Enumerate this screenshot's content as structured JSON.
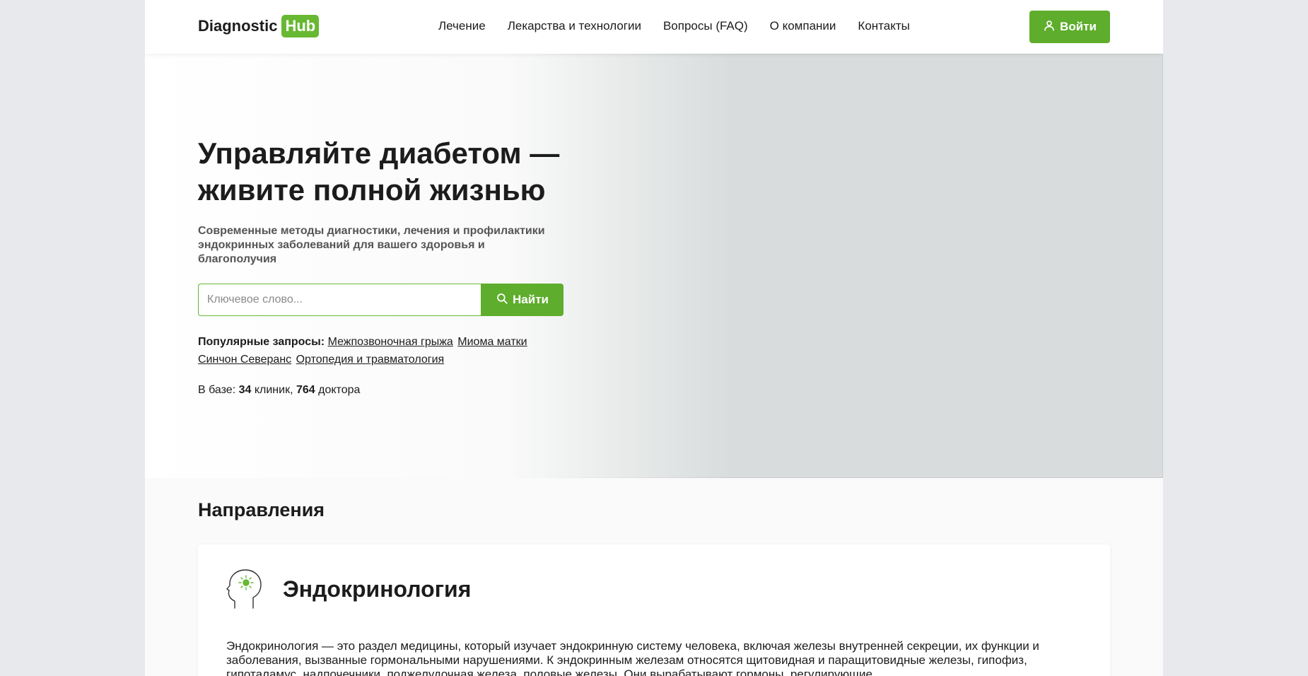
{
  "header": {
    "logo_text": "Diagnostic",
    "logo_badge": "Hub",
    "nav": [
      {
        "label": "Лечение"
      },
      {
        "label": "Лекарства и технологии"
      },
      {
        "label": "Вопросы (FAQ)"
      },
      {
        "label": "О компании"
      },
      {
        "label": "Контакты"
      }
    ],
    "login_label": "Войти"
  },
  "hero": {
    "title": "Управляйте диабетом — живите полной жизнью",
    "subtitle": "Современные методы диагностики, лечения и профилактики эндокринных заболеваний для вашего здоровья и благополучия",
    "search_placeholder": "Ключевое слово...",
    "search_button": "Найти",
    "popular_label": "Популярные запросы:",
    "popular_links": [
      {
        "label": "Межпозвоночная грыжа"
      },
      {
        "label": "Миома матки"
      },
      {
        "label": "Синчон Северанс"
      },
      {
        "label": "Ортопедия и травматология"
      }
    ],
    "stats_prefix": "В базе:",
    "clinics_count": "34",
    "clinics_word": "клиник,",
    "doctors_count": "764",
    "doctors_word": "доктора"
  },
  "directions": {
    "title": "Направления",
    "card": {
      "title": "Эндокринология",
      "text": "Эндокринология — это раздел медицины, который изучает эндокринную систему человека, включая железы внутренней секреции, их функции и заболевания, вызванные гормональными нарушениями. К эндокринным железам относятся щитовидная и паращитовидные железы, гипофиз, гипоталамус, надпочечники, поджелудочная железа, половые железы. Они вырабатывают гормоны, регулирующие"
    }
  },
  "colors": {
    "accent": "#5ead2c",
    "text": "#1c1c1c",
    "outer_background": "#e8e9ec"
  },
  "icons": {
    "login": "user-icon",
    "search": "search-icon",
    "card": "head-brain-icon"
  }
}
